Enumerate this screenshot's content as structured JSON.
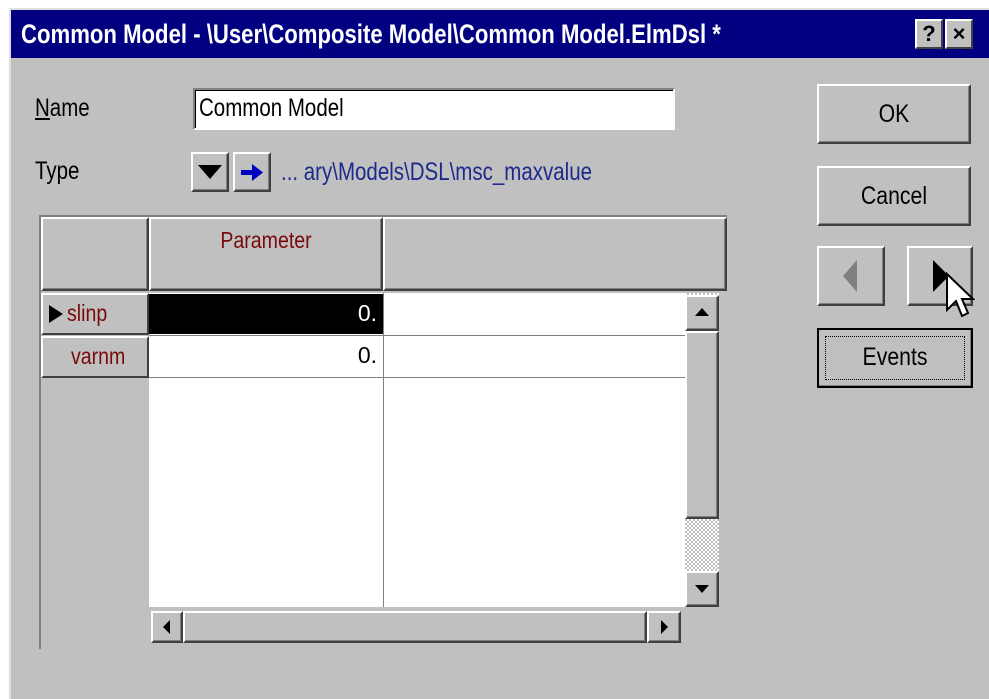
{
  "window": {
    "title": "Common Model - \\User\\Composite Model\\Common Model.ElmDsl *",
    "help_label": "?",
    "close_label": "×"
  },
  "form": {
    "name_label_first": "N",
    "name_label_rest": "ame",
    "name_value": "Common Model",
    "type_label": "Type",
    "type_path": "... ary\\Models\\DSL\\msc_maxvalue"
  },
  "grid": {
    "column_header": "Parameter",
    "rows": [
      {
        "name": "slinp",
        "value": "0."
      },
      {
        "name": "varnm",
        "value": "0."
      }
    ]
  },
  "buttons": {
    "ok": "OK",
    "cancel": "Cancel",
    "events": "Events"
  }
}
